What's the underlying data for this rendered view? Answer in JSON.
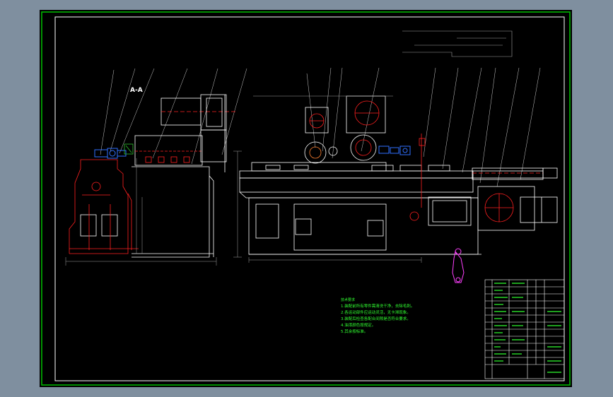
{
  "drawing": {
    "section_label": "A-A",
    "technical_requirements": [
      "技术要求",
      "1.装配前所有零件需清洗干净，去除毛刺。",
      "2.各运动部件应运动灵活，无卡滞现象。",
      "3.装配后检查各配合间隙是否符合要求。",
      "4.油漆颜色按规定。",
      "5.其余按标准。"
    ],
    "colors": {
      "page_bg": "#7f8f9f",
      "sheet_bg": "#000000",
      "frame": "#00c000",
      "outline": "#ffffff",
      "hidden_detail": "#ff2020",
      "component": "#3070ff",
      "dimension": "#a0a0a0",
      "note_text": "#30ff30",
      "handwheel": "#ff40ff"
    }
  }
}
